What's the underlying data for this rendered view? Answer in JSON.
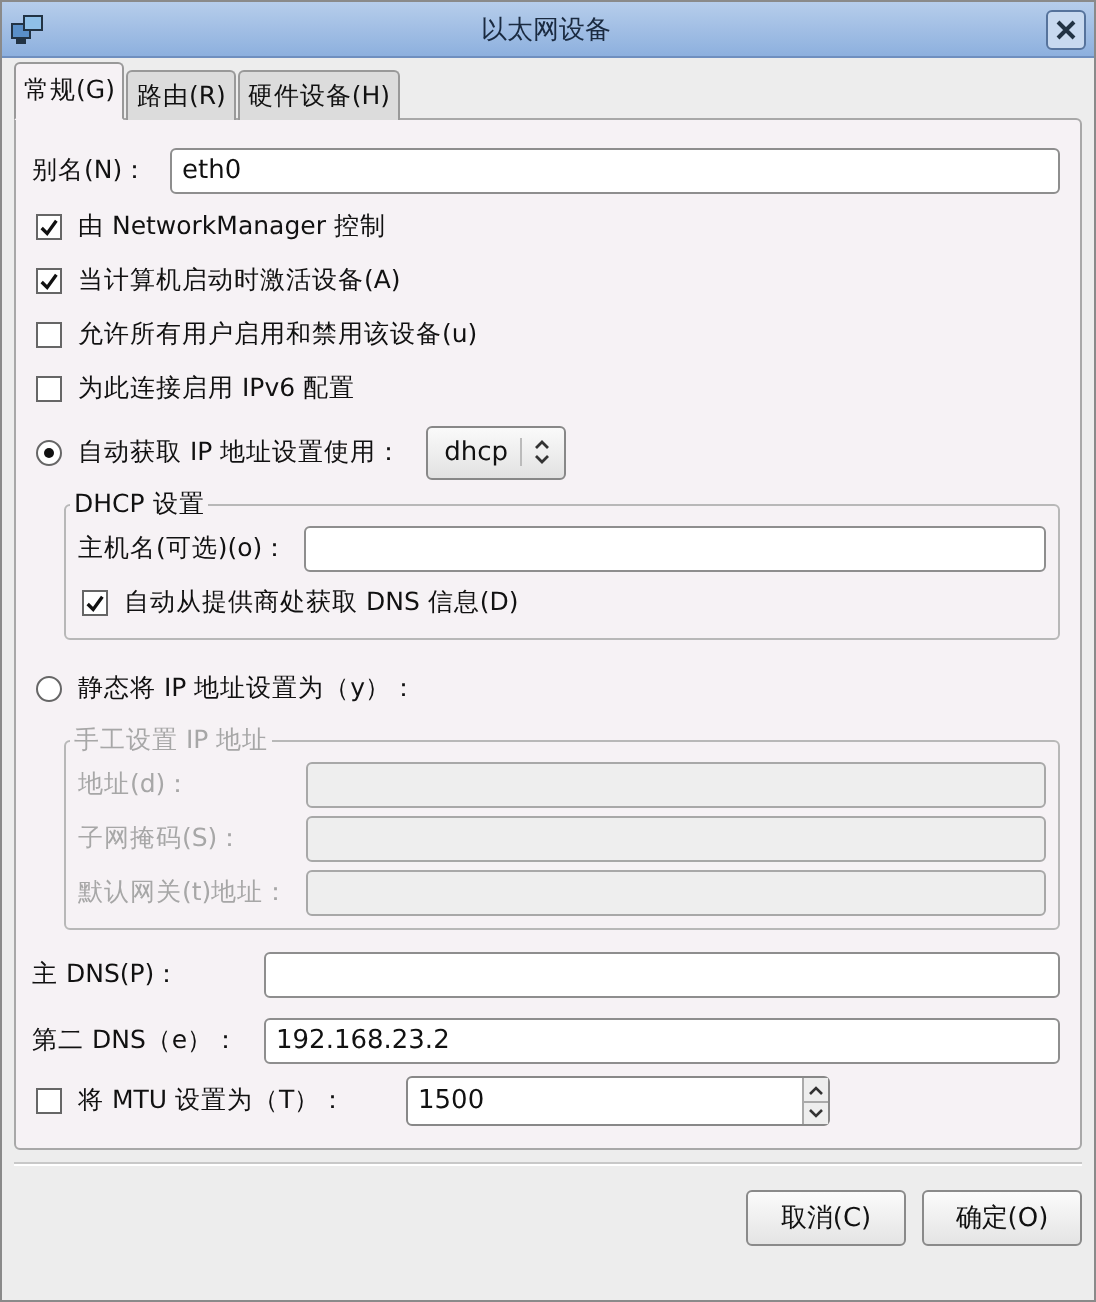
{
  "window": {
    "title": "以太网设备"
  },
  "tabs": [
    {
      "label": "常规(G)",
      "selected": true
    },
    {
      "label": "路由(R)",
      "selected": false
    },
    {
      "label": "硬件设备(H)",
      "selected": false
    }
  ],
  "alias": {
    "label": "别名(N)：",
    "value": "eth0"
  },
  "options": [
    {
      "label": "由 NetworkManager 控制",
      "checked": true
    },
    {
      "label": "当计算机启动时激活设备(A)",
      "checked": true
    },
    {
      "label": "允许所有用户启用和禁用该设备(u)",
      "checked": false
    },
    {
      "label": "为此连接启用 IPv6 配置",
      "checked": false
    }
  ],
  "auto_ip": {
    "label": "自动获取 IP 地址设置使用：",
    "selected": true,
    "method": "dhcp"
  },
  "dhcp": {
    "legend": "DHCP 设置",
    "hostname_label": "主机名(可选)(o)：",
    "dns_auto": {
      "label": "自动从提供商处获取 DNS 信息(D)",
      "checked": true
    }
  },
  "static_ip": {
    "label": "静态将 IP 地址设置为（y）：",
    "selected": false
  },
  "manual": {
    "legend": "手工设置 IP 地址",
    "disabled": true,
    "fields": [
      "地址(d)：",
      "子网掩码(S)：",
      "默认网关(t)地址："
    ]
  },
  "dns": [
    {
      "label": "主 DNS(P)："
    },
    {
      "label": "第二 DNS（e）：",
      "value": "192.168.23.2"
    }
  ],
  "mtu": {
    "label": "将 MTU 设置为（T）：",
    "checked": false,
    "value": "1500"
  },
  "buttons": [
    "取消(C)",
    "确定(O)"
  ]
}
